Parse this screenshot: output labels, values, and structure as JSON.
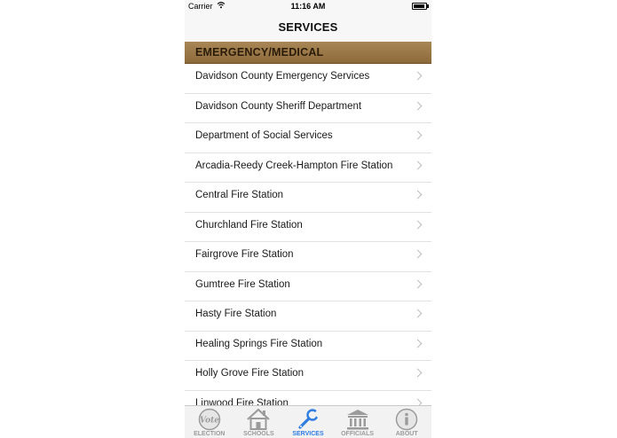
{
  "status_bar": {
    "carrier": "Carrier",
    "time": "11:16 AM"
  },
  "nav": {
    "title": "SERVICES"
  },
  "section": {
    "title": "EMERGENCY/MEDICAL"
  },
  "items": [
    "Davidson County Emergency Services",
    "Davidson County Sheriff Department",
    "Department of Social Services",
    "Arcadia-Reedy Creek-Hampton Fire Station",
    "Central Fire Station",
    "Churchland Fire Station",
    "Fairgrove Fire Station",
    "Gumtree Fire Station",
    "Hasty Fire Station",
    "Healing Springs Fire Station",
    "Holly Grove Fire Station",
    "Linwood Fire Station"
  ],
  "tabs": [
    {
      "label": "ELECTION",
      "icon": "vote-icon",
      "active": false
    },
    {
      "label": "SCHOOLS",
      "icon": "house-icon",
      "active": false
    },
    {
      "label": "SERVICES",
      "icon": "wrench-icon",
      "active": true
    },
    {
      "label": "OFFICIALS",
      "icon": "capitol-icon",
      "active": false
    },
    {
      "label": "ABOUT",
      "icon": "info-icon",
      "active": false
    }
  ],
  "colors": {
    "accent": "#2f7de1",
    "section_bg": "#9b7848",
    "inactive_tab": "#9b9b9b"
  }
}
